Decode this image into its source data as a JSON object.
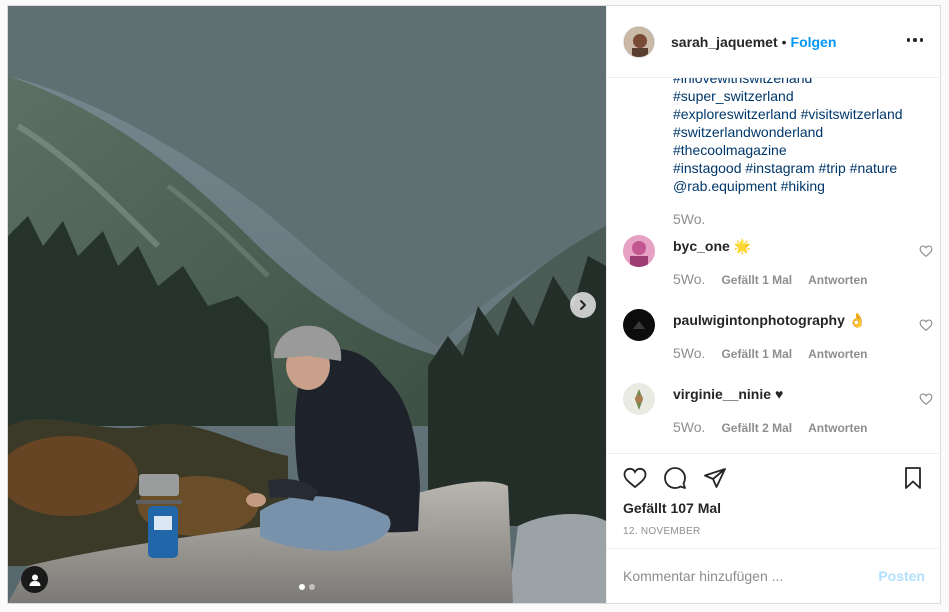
{
  "header": {
    "username": "sarah_jaquemet",
    "separator": "•",
    "follow_label": "Folgen",
    "more_icon": "more-horizontal-icon"
  },
  "caption": {
    "lines": [
      "#inlovewithswitzerland",
      "#super_switzerland",
      "#exploreswitzerland #visitswitzerland",
      "#switzerlandwonderland",
      "#thecoolmagazine",
      "#instagood #instagram #trip #nature",
      "@rab.equipment #hiking"
    ],
    "time": "5Wo."
  },
  "comments": [
    {
      "user": "byc_one",
      "emoji": "🌟",
      "time": "5Wo.",
      "likes": "Gefällt 1 Mal",
      "reply": "Antworten"
    },
    {
      "user": "paulwigintonphotography",
      "emoji": "👌",
      "time": "5Wo.",
      "likes": "Gefällt 1 Mal",
      "reply": "Antworten"
    },
    {
      "user": "virginie__ninie",
      "emoji": "♥",
      "time": "5Wo.",
      "likes": "Gefällt 2 Mal",
      "reply": "Antworten"
    }
  ],
  "actions": {
    "likes": "Gefällt 107 Mal",
    "date": "12. NOVEMBER"
  },
  "add_comment": {
    "placeholder": "Kommentar hinzufügen ...",
    "post_label": "Posten"
  },
  "colors": {
    "link": "#00376b",
    "accent": "#0095f6",
    "muted": "#8e8e8e",
    "post_disabled": "#b2dffc"
  }
}
